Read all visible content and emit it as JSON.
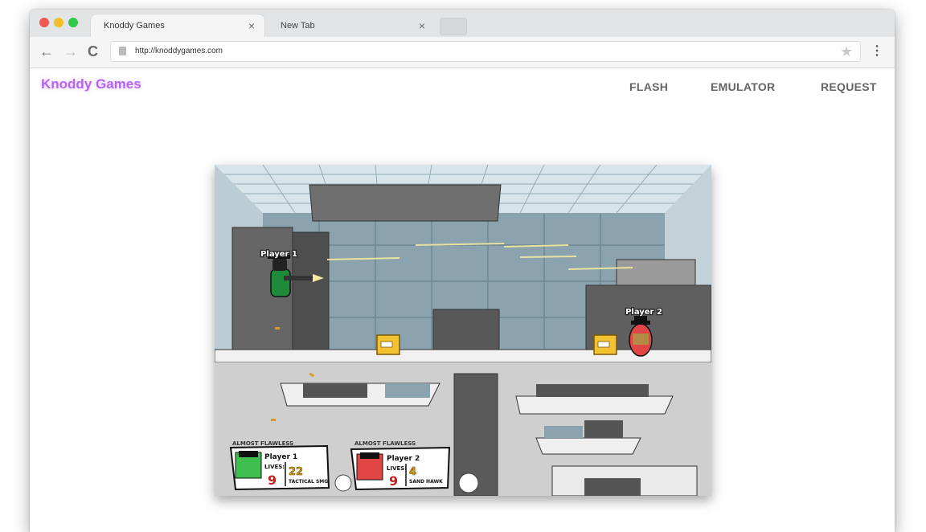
{
  "browser": {
    "tabs": [
      {
        "title": "Knoddy Games",
        "close": "×"
      },
      {
        "title": "New Tab",
        "close": "×"
      }
    ],
    "url": "http://knoddygames.com",
    "icons": {
      "back": "←",
      "forward": "→",
      "reload": "C",
      "star": "★",
      "menu": "⋮"
    }
  },
  "site": {
    "brand": "Knoddy Games",
    "nav": [
      "FLASH",
      "EMULATOR",
      "REQUEST"
    ],
    "brand_color": "#b565f2"
  },
  "game": {
    "player1_tag": "Player 1",
    "player2_tag": "Player 2",
    "hud": [
      {
        "badge": "ALMOST FLAWLESS",
        "name": "Player 1",
        "lives_label": "LIVES:",
        "lives": "9",
        "ammo": "22",
        "weapon": "TACTICAL SMG"
      },
      {
        "badge": "ALMOST FLAWLESS",
        "name": "Player 2",
        "lives_label": "LIVES:",
        "lives": "9",
        "ammo": "4",
        "weapon": "SAND HAWK"
      }
    ]
  }
}
